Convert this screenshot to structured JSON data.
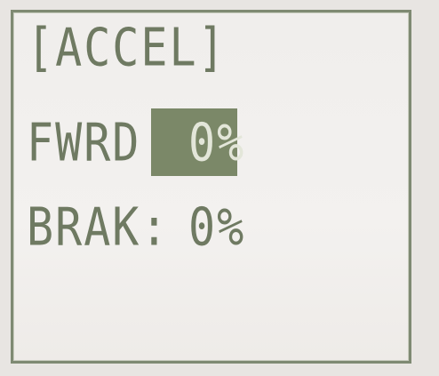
{
  "screen": {
    "title": "[ACCEL]",
    "rows": [
      {
        "label": "FWRD:",
        "value": "0%",
        "selected": true
      },
      {
        "label": "BRAK:",
        "value": "0%",
        "selected": false
      }
    ]
  },
  "colors": {
    "lcd_background": "#f0eeec",
    "lcd_text": "#6f7a62",
    "highlight": "#7b8868",
    "highlight_text": "#e3e6d9",
    "frame": "#7f8a73"
  }
}
